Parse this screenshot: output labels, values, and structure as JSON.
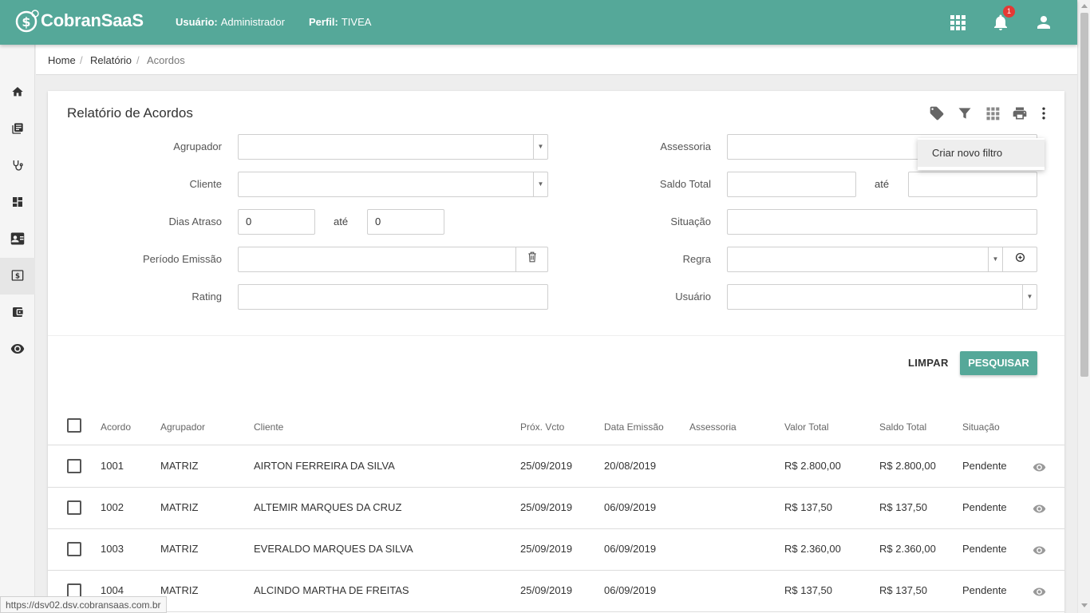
{
  "app": {
    "logo_text": "CobranSaaS",
    "user_label": "Usuário:",
    "user_value": "Administrador",
    "profile_label": "Perfil:",
    "profile_value": "TIVEA",
    "notification_count": "1"
  },
  "sidebar": {
    "items": [
      {
        "icon": "home-icon"
      },
      {
        "icon": "book-icon"
      },
      {
        "icon": "stethoscope-icon"
      },
      {
        "icon": "dashboard-icon"
      },
      {
        "icon": "contact-card-icon"
      },
      {
        "icon": "money-icon",
        "active": true
      },
      {
        "icon": "wallet-icon"
      },
      {
        "icon": "eye-icon"
      }
    ]
  },
  "breadcrumb": {
    "items": [
      "Home",
      "Relatório",
      "Acordos"
    ]
  },
  "page": {
    "title": "Relatório de Acordos"
  },
  "toolbar_menu": {
    "item": "Criar novo filtro"
  },
  "filters": {
    "agrupador_label": "Agrupador",
    "cliente_label": "Cliente",
    "dias_atraso_label": "Dias Atraso",
    "dias_atraso_from": "0",
    "dias_atraso_to": "0",
    "ate_label": "até",
    "periodo_emissao_label": "Período Emissão",
    "rating_label": "Rating",
    "assessoria_label": "Assessoria",
    "saldo_total_label": "Saldo Total",
    "situacao_label": "Situação",
    "regra_label": "Regra",
    "usuario_label": "Usuário"
  },
  "actions": {
    "clear_label": "LIMPAR",
    "search_label": "PESQUISAR"
  },
  "table": {
    "headers": {
      "acordo": "Acordo",
      "agrupador": "Agrupador",
      "cliente": "Cliente",
      "prox_vcto": "Próx. Vcto",
      "data_emissao": "Data Emissão",
      "assessoria": "Assessoria",
      "valor_total": "Valor Total",
      "saldo_total": "Saldo Total",
      "situacao": "Situação"
    },
    "rows": [
      {
        "acordo": "1001",
        "agrupador": "MATRIZ",
        "cliente": "AIRTON FERREIRA DA SILVA",
        "prox_vcto": "25/09/2019",
        "data_emissao": "20/08/2019",
        "assessoria": "",
        "valor_total": "R$ 2.800,00",
        "saldo_total": "R$ 2.800,00",
        "situacao": "Pendente"
      },
      {
        "acordo": "1002",
        "agrupador": "MATRIZ",
        "cliente": "ALTEMIR MARQUES DA CRUZ",
        "prox_vcto": "25/09/2019",
        "data_emissao": "06/09/2019",
        "assessoria": "",
        "valor_total": "R$ 137,50",
        "saldo_total": "R$ 137,50",
        "situacao": "Pendente"
      },
      {
        "acordo": "1003",
        "agrupador": "MATRIZ",
        "cliente": "EVERALDO MARQUES DA SILVA",
        "prox_vcto": "25/09/2019",
        "data_emissao": "06/09/2019",
        "assessoria": "",
        "valor_total": "R$ 2.360,00",
        "saldo_total": "R$ 2.360,00",
        "situacao": "Pendente"
      },
      {
        "acordo": "1004",
        "agrupador": "MATRIZ",
        "cliente": "ALCINDO MARTHA DE FREITAS",
        "prox_vcto": "25/09/2019",
        "data_emissao": "06/09/2019",
        "assessoria": "",
        "valor_total": "R$ 137,50",
        "saldo_total": "R$ 137,50",
        "situacao": "Pendente"
      }
    ]
  },
  "statusbar": {
    "url": "https://dsv02.dsv.cobransaas.com.br"
  },
  "colors": {
    "primary": "#55a899",
    "badge": "#e53935"
  }
}
